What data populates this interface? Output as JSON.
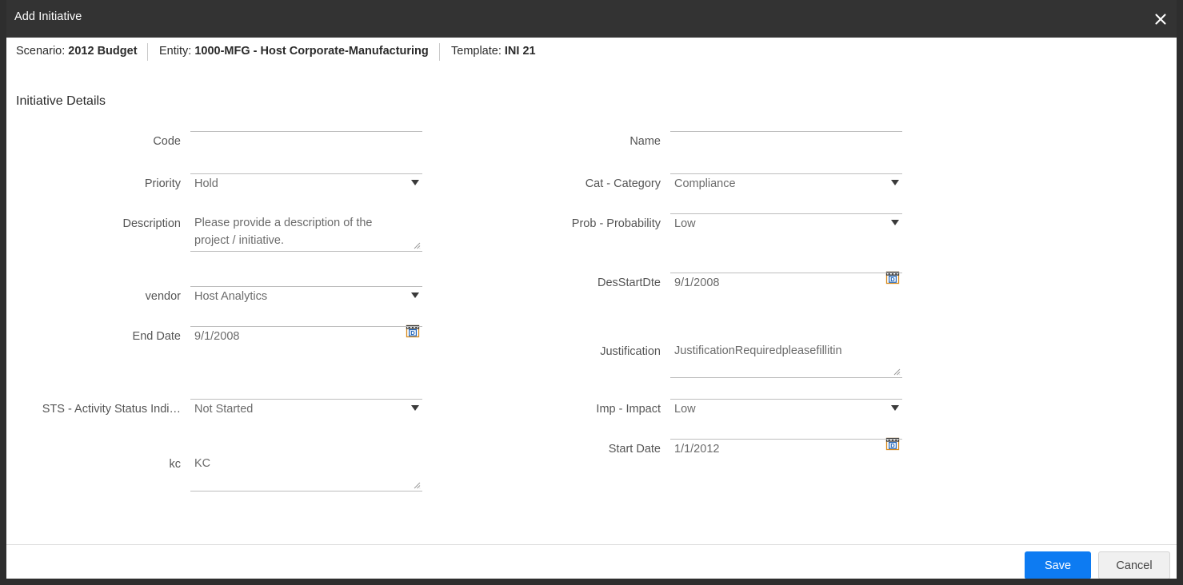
{
  "window": {
    "title": "Add Initiative",
    "close_icon": "close-icon"
  },
  "context": {
    "scenario_label": "Scenario:",
    "scenario_value": "2012 Budget",
    "entity_label": "Entity:",
    "entity_value": "1000-MFG - Host Corporate-Manufacturing",
    "template_label": "Template:",
    "template_value": "INI 21"
  },
  "section": {
    "title": "Initiative Details"
  },
  "left_fields": {
    "code": {
      "label": "Code",
      "value": ""
    },
    "priority": {
      "label": "Priority",
      "value": "Hold"
    },
    "description": {
      "label": "Description",
      "value": "Please provide a description of the project / initiative."
    },
    "vendor": {
      "label": "vendor",
      "value": "Host Analytics"
    },
    "end_date": {
      "label": "End Date",
      "value": "9/1/2008"
    },
    "sts": {
      "label": "STS - Activity Status Indi…",
      "value": "Not Started"
    },
    "kc": {
      "label": "kc",
      "value": "KC"
    }
  },
  "right_fields": {
    "name": {
      "label": "Name",
      "value": ""
    },
    "category": {
      "label": "Cat - Category",
      "value": "Compliance"
    },
    "probability": {
      "label": "Prob - Probability",
      "value": "Low"
    },
    "des_start_date": {
      "label": "DesStartDte",
      "value": "9/1/2008"
    },
    "justification": {
      "label": "Justification",
      "value": "JustificationRequiredpleasefillitin"
    },
    "impact": {
      "label": "Imp - Impact",
      "value": "Low"
    },
    "start_date": {
      "label": "Start Date",
      "value": "1/1/2012"
    }
  },
  "footer": {
    "save_label": "Save",
    "cancel_label": "Cancel"
  },
  "colors": {
    "titlebar": "#333333",
    "accent": "#0d7bf2",
    "cancel_bg": "#f0f0f0",
    "underline": "#bdbdbd",
    "label_text": "#555555",
    "value_text": "#6b6b6b"
  }
}
